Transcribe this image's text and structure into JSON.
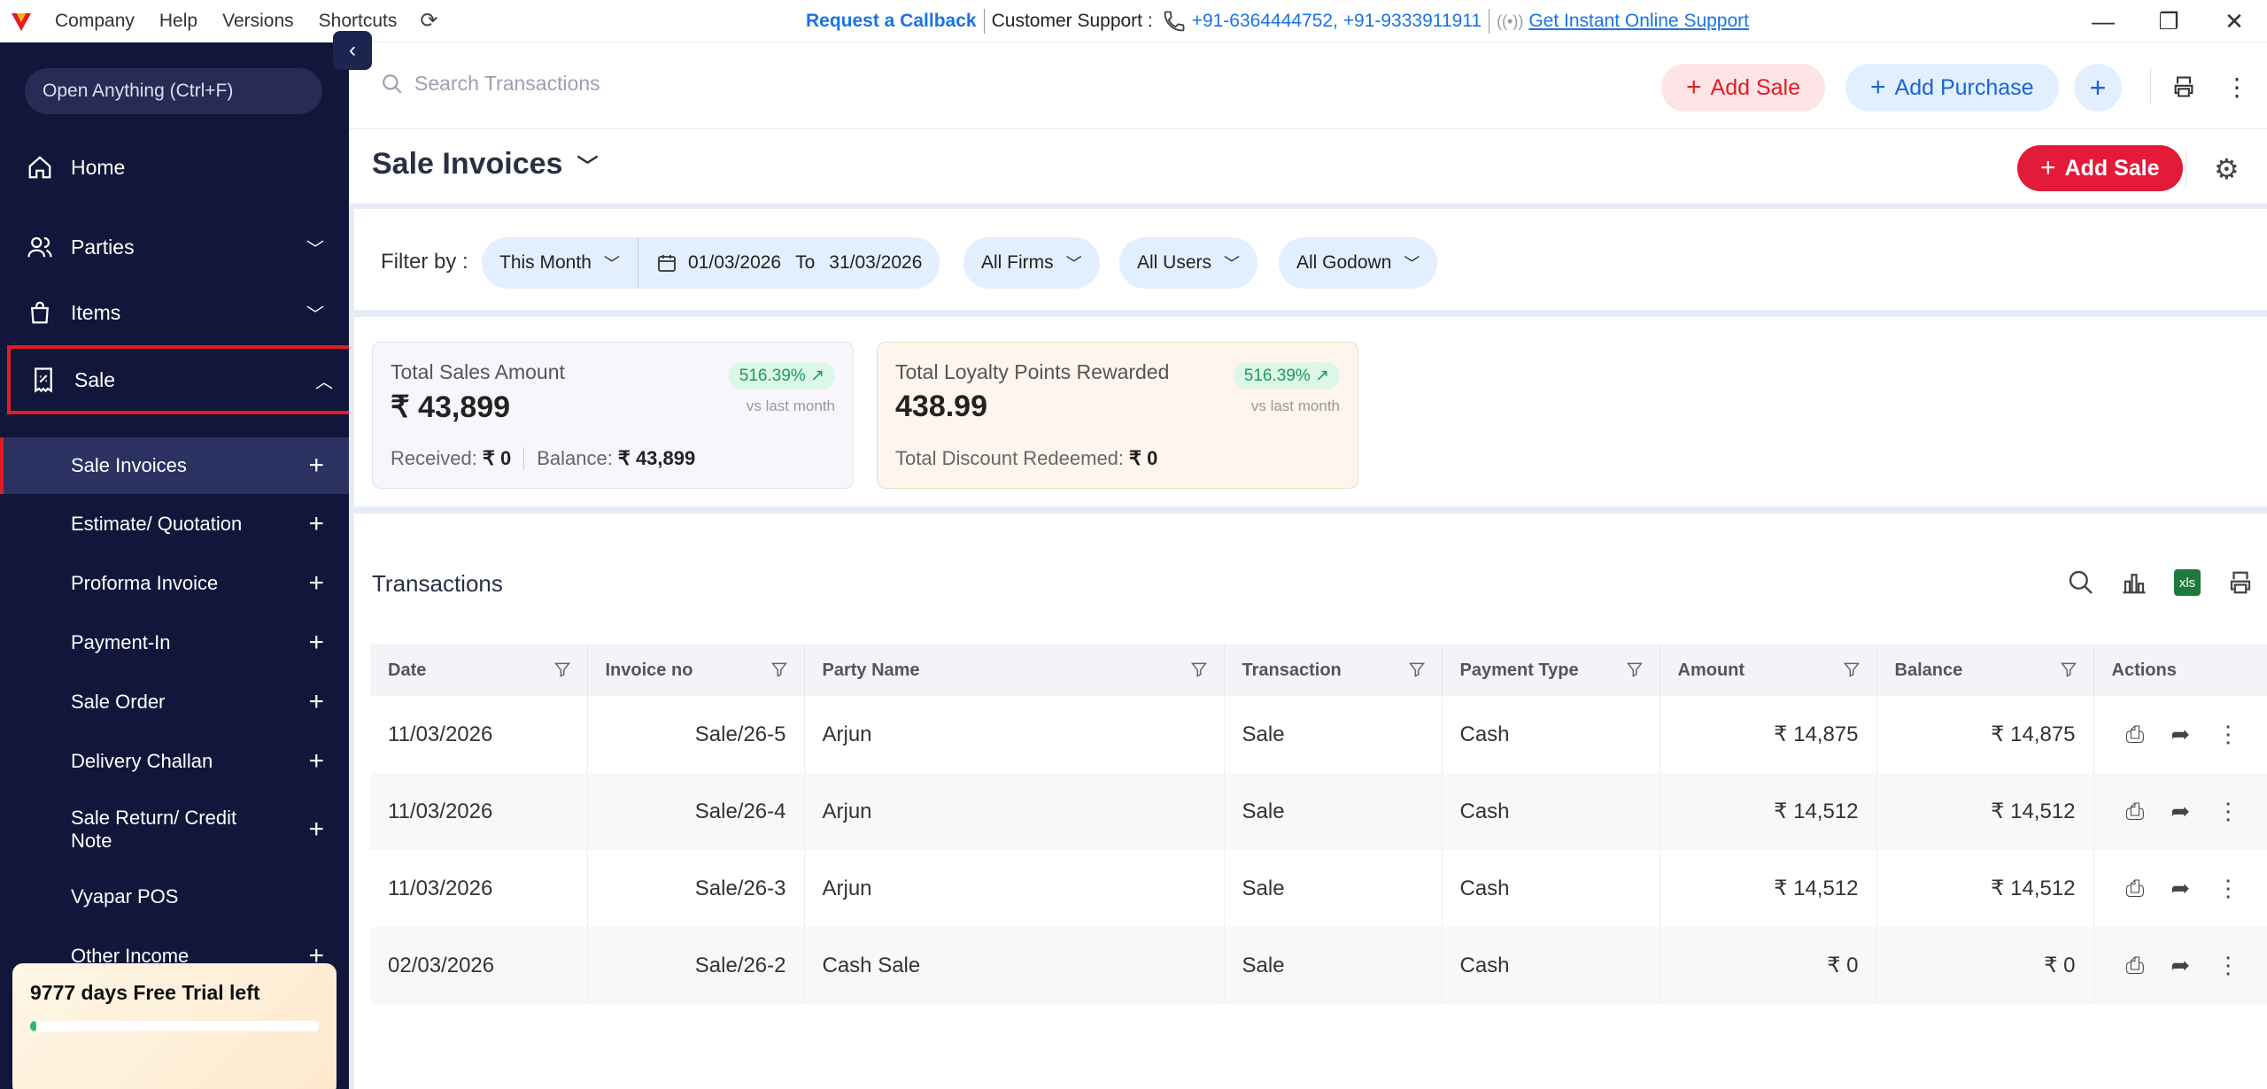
{
  "titlebar": {
    "menu": [
      "Company",
      "Help",
      "Versions",
      "Shortcuts"
    ],
    "request_callback": "Request a Callback",
    "support_label": "Customer Support :",
    "phones": "+91-6364444752, +91-9333911911",
    "online_support": "Get Instant Online Support"
  },
  "sidebar": {
    "open_anything": "Open Anything (Ctrl+F)",
    "items": [
      "Home",
      "Parties",
      "Items",
      "Sale"
    ],
    "sub_items": [
      "Sale Invoices",
      "Estimate/ Quotation",
      "Proforma Invoice",
      "Payment-In",
      "Sale Order",
      "Delivery Challan",
      "Sale Return/ Credit Note",
      "Vyapar POS",
      "Other Income"
    ],
    "trial_text": "9777 days Free Trial left",
    "trial_progress": 0.02
  },
  "toolbar": {
    "search_placeholder": "Search Transactions",
    "add_sale": "Add Sale",
    "add_purchase": "Add Purchase"
  },
  "page": {
    "title": "Sale Invoices",
    "add_sale": "Add Sale"
  },
  "filters": {
    "label": "Filter by :",
    "period": "This Month",
    "date_from": "01/03/2026",
    "date_to_label": "To",
    "date_to": "31/03/2026",
    "firms": "All Firms",
    "users": "All Users",
    "godown": "All Godown"
  },
  "cards": {
    "sales": {
      "title": "Total Sales Amount",
      "value": "₹ 43,899",
      "badge": "516.39%",
      "vs": "vs last month",
      "received_label": "Received:",
      "received": "₹ 0",
      "balance_label": "Balance:",
      "balance": "₹ 43,899"
    },
    "loyalty": {
      "title": "Total Loyalty Points Rewarded",
      "value": "438.99",
      "badge": "516.39%",
      "vs": "vs last month",
      "discount_label": "Total Discount Redeemed:",
      "discount": "₹ 0"
    }
  },
  "transactions": {
    "title": "Transactions",
    "xls": "xls",
    "columns": [
      "Date",
      "Invoice no",
      "Party Name",
      "Transaction",
      "Payment Type",
      "Amount",
      "Balance",
      "Actions"
    ],
    "rows": [
      {
        "date": "11/03/2026",
        "invoice": "Sale/26-5",
        "party": "Arjun",
        "type": "Sale",
        "payment": "Cash",
        "amount": "₹ 14,875",
        "balance": "₹ 14,875"
      },
      {
        "date": "11/03/2026",
        "invoice": "Sale/26-4",
        "party": "Arjun",
        "type": "Sale",
        "payment": "Cash",
        "amount": "₹ 14,512",
        "balance": "₹ 14,512"
      },
      {
        "date": "11/03/2026",
        "invoice": "Sale/26-3",
        "party": "Arjun",
        "type": "Sale",
        "payment": "Cash",
        "amount": "₹ 14,512",
        "balance": "₹ 14,512"
      },
      {
        "date": "02/03/2026",
        "invoice": "Sale/26-2",
        "party": "Cash Sale",
        "type": "Sale",
        "payment": "Cash",
        "amount": "₹ 0",
        "balance": "₹ 0"
      }
    ]
  },
  "colors": {
    "sidebar_bg": "#11163a",
    "accent_red": "#e31b23",
    "accent_blue": "#1a64d6",
    "badge_green": "#1a9c5b"
  }
}
